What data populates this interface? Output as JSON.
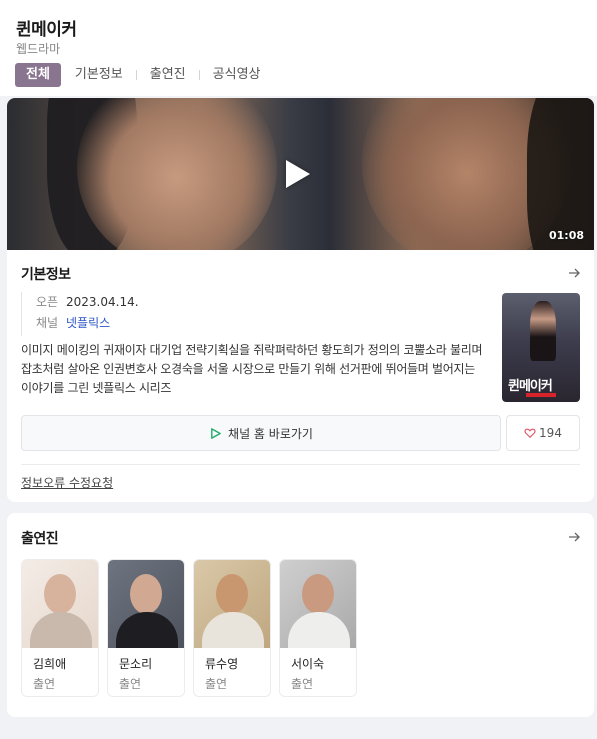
{
  "header": {
    "title": "퀸메이커",
    "genre": "웹드라마",
    "tabs": [
      {
        "label": "전체",
        "active": true
      },
      {
        "label": "기본정보",
        "active": false
      },
      {
        "label": "출연진",
        "active": false
      },
      {
        "label": "공식영상",
        "active": false
      }
    ]
  },
  "video": {
    "duration": "01:08"
  },
  "basic_info": {
    "section_title": "기본정보",
    "rows": [
      {
        "key": "오픈",
        "value": "2023.04.14."
      },
      {
        "key": "채널",
        "value": "넷플릭스"
      }
    ],
    "description": "이미지 메이킹의 귀재이자 대기업 전략기획실을 쥐락펴락하던 황도희가 정의의 코뿔소라 불리며 잡초처럼 살아온 인권변호사 오경숙을 서울 시장으로 만들기 위해 선거판에 뛰어들며 벌어지는 이야기를 그린 넷플릭스 시리즈",
    "poster_title": "퀸메이커",
    "channel_button": "채널 홈 바로가기",
    "like_count": "194",
    "report_link": "정보오류 수정요청"
  },
  "cast_section": {
    "section_title": "출연진",
    "members": [
      {
        "name": "김희애",
        "role": "출연"
      },
      {
        "name": "문소리",
        "role": "출연"
      },
      {
        "name": "류수영",
        "role": "출연"
      },
      {
        "name": "서이숙",
        "role": "출연"
      }
    ]
  },
  "colors": {
    "active_tab": "#8a7591",
    "link": "#2d56c7",
    "play_icon": "#1fae6a",
    "like_heart": "#e0526a"
  }
}
